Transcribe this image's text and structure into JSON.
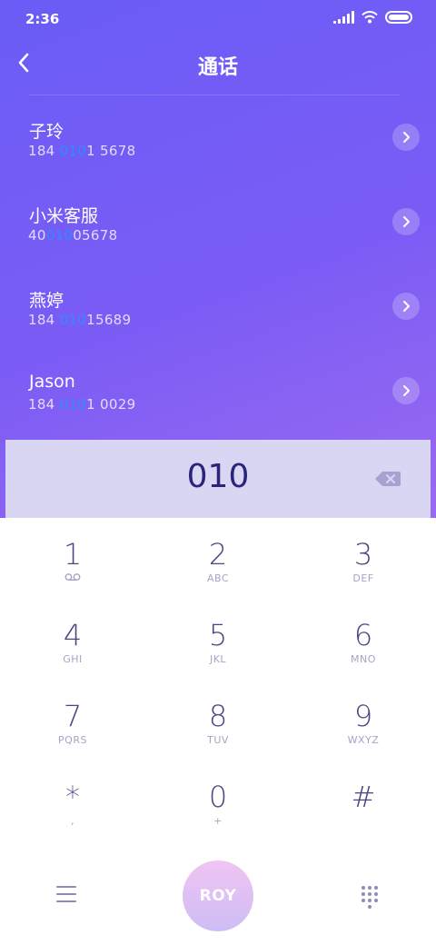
{
  "status_bar": {
    "time": "2:36"
  },
  "header": {
    "title": "通话"
  },
  "contacts": [
    {
      "name": "子玲",
      "number_pre": "184 ",
      "number_match": "010",
      "number_post": "1 5678"
    },
    {
      "name": "小米客服",
      "number_pre": "40",
      "number_match": "010",
      "number_post": "05678"
    },
    {
      "name": "燕婷",
      "number_pre": "184 ",
      "number_match": "010",
      "number_post": "15689"
    },
    {
      "name": "Jason",
      "number_pre": "184 ",
      "number_match": "010",
      "number_post": "1 0029"
    }
  ],
  "dial_display": {
    "digits": "010"
  },
  "keypad": {
    "keys": [
      {
        "digit": "1",
        "letters": ""
      },
      {
        "digit": "2",
        "letters": "ABC"
      },
      {
        "digit": "3",
        "letters": "DEF"
      },
      {
        "digit": "4",
        "letters": "GHI"
      },
      {
        "digit": "5",
        "letters": "JKL"
      },
      {
        "digit": "6",
        "letters": "MNO"
      },
      {
        "digit": "7",
        "letters": "PQRS"
      },
      {
        "digit": "8",
        "letters": "TUV"
      },
      {
        "digit": "9",
        "letters": "WXYZ"
      },
      {
        "digit": "*",
        "letters": ","
      },
      {
        "digit": "0",
        "letters": "+"
      },
      {
        "digit": "#",
        "letters": ""
      }
    ]
  },
  "bottom_bar": {
    "call_label": "ROY"
  },
  "colors": {
    "gradient_start": "#6a5cf6",
    "gradient_end": "#9a6af0",
    "match_highlight": "#2f8cff",
    "display_bg": "#d8d6f3",
    "digit_text": "#4a4583"
  },
  "icons": {
    "back": "chevron-left-icon",
    "contact_arrow": "chevron-right-icon",
    "backspace": "backspace-icon",
    "voicemail": "voicemail-icon",
    "menu": "menu-icon",
    "dialpad": "dialpad-icon"
  }
}
